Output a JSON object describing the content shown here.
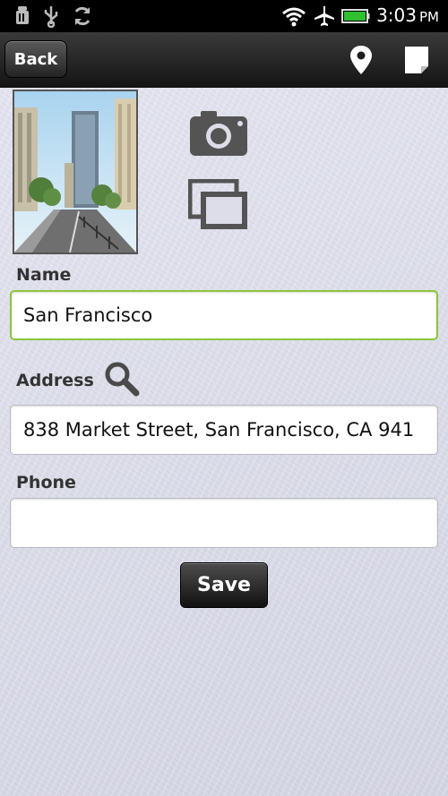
{
  "status_bar": {
    "time": "3:03",
    "ampm": "PM",
    "icons": [
      "debug-icon",
      "usb-icon",
      "sync-icon",
      "wifi-icon",
      "airplane-icon",
      "battery-icon"
    ],
    "battery_color": "#2fbf2f"
  },
  "action_bar": {
    "back_label": "Back",
    "icons": [
      "map-pin-icon",
      "note-icon"
    ]
  },
  "photo": {
    "description_icon": "street-photo"
  },
  "side_icons": [
    "camera-icon",
    "gallery-icon"
  ],
  "form": {
    "name_label": "Name",
    "name_value": "San Francisco",
    "address_label": "Address",
    "address_value": "838 Market Street, San Francisco, CA 941",
    "phone_label": "Phone",
    "phone_value": "",
    "save_label": "Save"
  },
  "colors": {
    "focus_border": "#8cc63f",
    "label_text": "#333333"
  }
}
